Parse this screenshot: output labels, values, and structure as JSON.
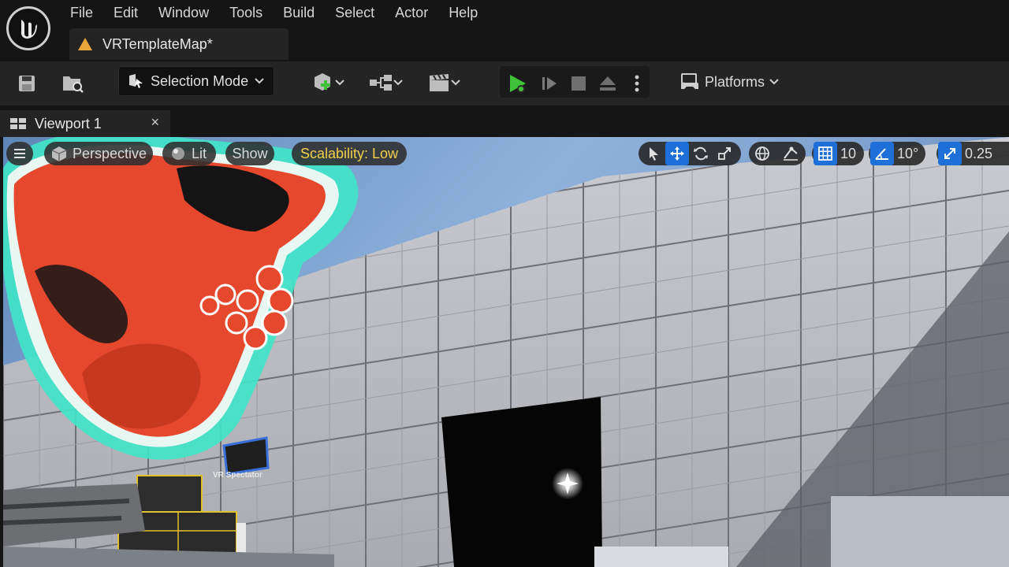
{
  "app": {
    "logo_icon": "unreal-engine-logo-icon"
  },
  "menubar": {
    "items": [
      {
        "label": "File"
      },
      {
        "label": "Edit"
      },
      {
        "label": "Window"
      },
      {
        "label": "Tools"
      },
      {
        "label": "Build"
      },
      {
        "label": "Select"
      },
      {
        "label": "Actor"
      },
      {
        "label": "Help"
      }
    ]
  },
  "document_tab": {
    "label": "VRTemplateMap*",
    "icon": "level-warning-icon"
  },
  "toolbar": {
    "selection_mode_label": "Selection Mode",
    "platforms_label": "Platforms",
    "play_color": "#3fc23a"
  },
  "viewport_tab": {
    "label": "Viewport 1",
    "close_glyph": "×"
  },
  "viewport": {
    "perspective_label": "Perspective",
    "lit_label": "Lit",
    "show_label": "Show",
    "scalability_label": "Scalability: Low",
    "grid_snap_value": "10",
    "rotation_snap_value": "10°",
    "scale_snap_value": "0.25",
    "vr_spectator_label": "VR Spectator",
    "accent_color": "#1f6fd9"
  }
}
